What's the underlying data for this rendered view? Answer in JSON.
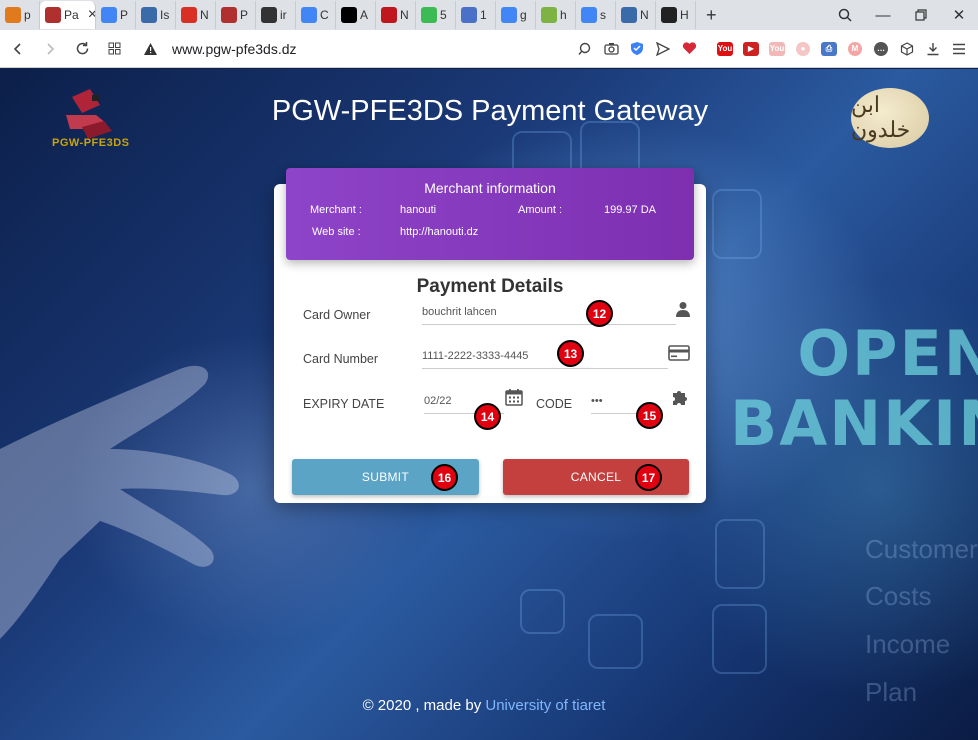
{
  "browser": {
    "tabs": [
      {
        "favicon": "pma-icon",
        "label": "p",
        "color": "#e07a1e",
        "active": false
      },
      {
        "favicon": "pgw-icon",
        "label": "Pa",
        "color": "#b03030",
        "active": true
      },
      {
        "favicon": "docs-icon",
        "label": "P",
        "color": "#4285f4",
        "active": false
      },
      {
        "favicon": "bank-icon",
        "label": "Is",
        "color": "#3a6aa8",
        "active": false
      },
      {
        "favicon": "gmail-icon",
        "label": "N",
        "color": "#d93025",
        "active": false
      },
      {
        "favicon": "pgw-icon",
        "label": "P",
        "color": "#b03030",
        "active": false
      },
      {
        "favicon": "doc-icon",
        "label": "ir",
        "color": "#333333",
        "active": false
      },
      {
        "favicon": "translate-icon",
        "label": "C",
        "color": "#4285f4",
        "active": false
      },
      {
        "favicon": "lu-icon",
        "label": "A",
        "color": "#000000",
        "active": false
      },
      {
        "favicon": "m-icon",
        "label": "N",
        "color": "#c0171e",
        "active": false
      },
      {
        "favicon": "check-icon",
        "label": "5",
        "color": "#3cba54",
        "active": false
      },
      {
        "favicon": "c-icon",
        "label": "1",
        "color": "#4a70c8",
        "active": false
      },
      {
        "favicon": "google-icon",
        "label": "g",
        "color": "#4285f4",
        "active": false
      },
      {
        "favicon": "yh-icon",
        "label": "h",
        "color": "#7cb342",
        "active": false
      },
      {
        "favicon": "google-icon",
        "label": "s",
        "color": "#4285f4",
        "active": false
      },
      {
        "favicon": "bank-icon",
        "label": "N",
        "color": "#3a6aa8",
        "active": false
      },
      {
        "favicon": "terminal-icon",
        "label": "H",
        "color": "#222222",
        "active": false
      }
    ],
    "url": "www.pgw-pfe3ds.dz"
  },
  "header": {
    "title": "PGW-PFE3DS Payment Gateway",
    "logo_text": "PGW-PFE3DS",
    "univ_logo_text": "ابن خلدون"
  },
  "merchant": {
    "title": "Merchant information",
    "merchant_label": "Merchant :",
    "merchant_value": "hanouti",
    "amount_label": "Amount :",
    "amount_value": "199.97 DA",
    "website_label": "Web site :",
    "website_value": "http://hanouti.dz"
  },
  "payment": {
    "title": "Payment Details",
    "card_owner_label": "Card Owner",
    "card_owner_value": "bouchrit lahcen",
    "card_number_label": "Card Number",
    "card_number_value": "1111-2222-3333-4445",
    "expiry_label": "EXPIRY DATE",
    "expiry_value": "02/22",
    "code_label": "CODE",
    "code_value": "•••",
    "submit_label": "SUBMIT",
    "cancel_label": "CANCEL"
  },
  "markers": [
    "12",
    "13",
    "14",
    "15",
    "16",
    "17"
  ],
  "background": {
    "headline_1": "OPEN",
    "headline_2": "BANKING",
    "words": [
      "Customers",
      "Costs",
      "Income",
      "Plan"
    ]
  },
  "footer": {
    "prefix": "© 2020 , made by ",
    "link": "University of tiaret"
  },
  "colors": {
    "merchant_bg": "#8e44c9",
    "submit": "#5ba4c6",
    "cancel": "#c4403f",
    "marker": "#e0000f"
  }
}
